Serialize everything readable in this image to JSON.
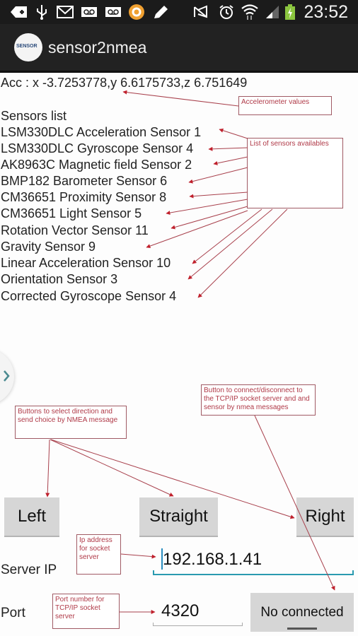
{
  "status_bar": {
    "left_icons": [
      "add-icon",
      "usb-icon",
      "gmail-icon",
      "voicemail-icon",
      "voicemail-icon",
      "app-notification-icon",
      "edit-icon"
    ],
    "right_icons": [
      "mute-icon",
      "alarm-icon",
      "wifi-icon",
      "signal-icon",
      "battery-charging-icon"
    ],
    "time": "23:52"
  },
  "action_bar": {
    "logo_text": "SENSOR",
    "title": "sensor2nmea"
  },
  "accelerometer": {
    "text": "Acc : x -3.7253778,y 6.6175733,z 6.751649"
  },
  "sensors": {
    "title": "Sensors list",
    "items": [
      "LSM330DLC Acceleration Sensor 1",
      "LSM330DLC Gyroscope Sensor 4",
      "AK8963C Magnetic field Sensor 2",
      "BMP182 Barometer Sensor 6",
      "CM36651 Proximity Sensor 8",
      "CM36651 Light Sensor 5",
      "Rotation Vector Sensor 11",
      "Gravity Sensor 9",
      "Linear Acceleration Sensor 10",
      "Orientation Sensor 3",
      "Corrected Gyroscope Sensor 4"
    ]
  },
  "annotations": {
    "accelerometer": "Accelerometer values",
    "sensors": "List of sensors availables",
    "connect": "Button to connect/disconnect to the TCP/IP socket server and and sensor by nmea messages",
    "direction": "Buttons to select direction and send choice by NMEA message",
    "ip": "Ip address for socket server",
    "port": "Port number for TCP/IP socket server"
  },
  "direction_buttons": {
    "left": "Left",
    "straight": "Straight",
    "right": "Right"
  },
  "server": {
    "ip_label": "Server IP",
    "ip_value": "192.168.1.41",
    "port_label": "Port",
    "port_value": "4320",
    "connect_button": "No connected"
  },
  "colors": {
    "annotation": "#b03a48",
    "focus_underline": "#2a9bb0",
    "status_bar": "#1b1b1b",
    "action_bar": "#222222"
  }
}
